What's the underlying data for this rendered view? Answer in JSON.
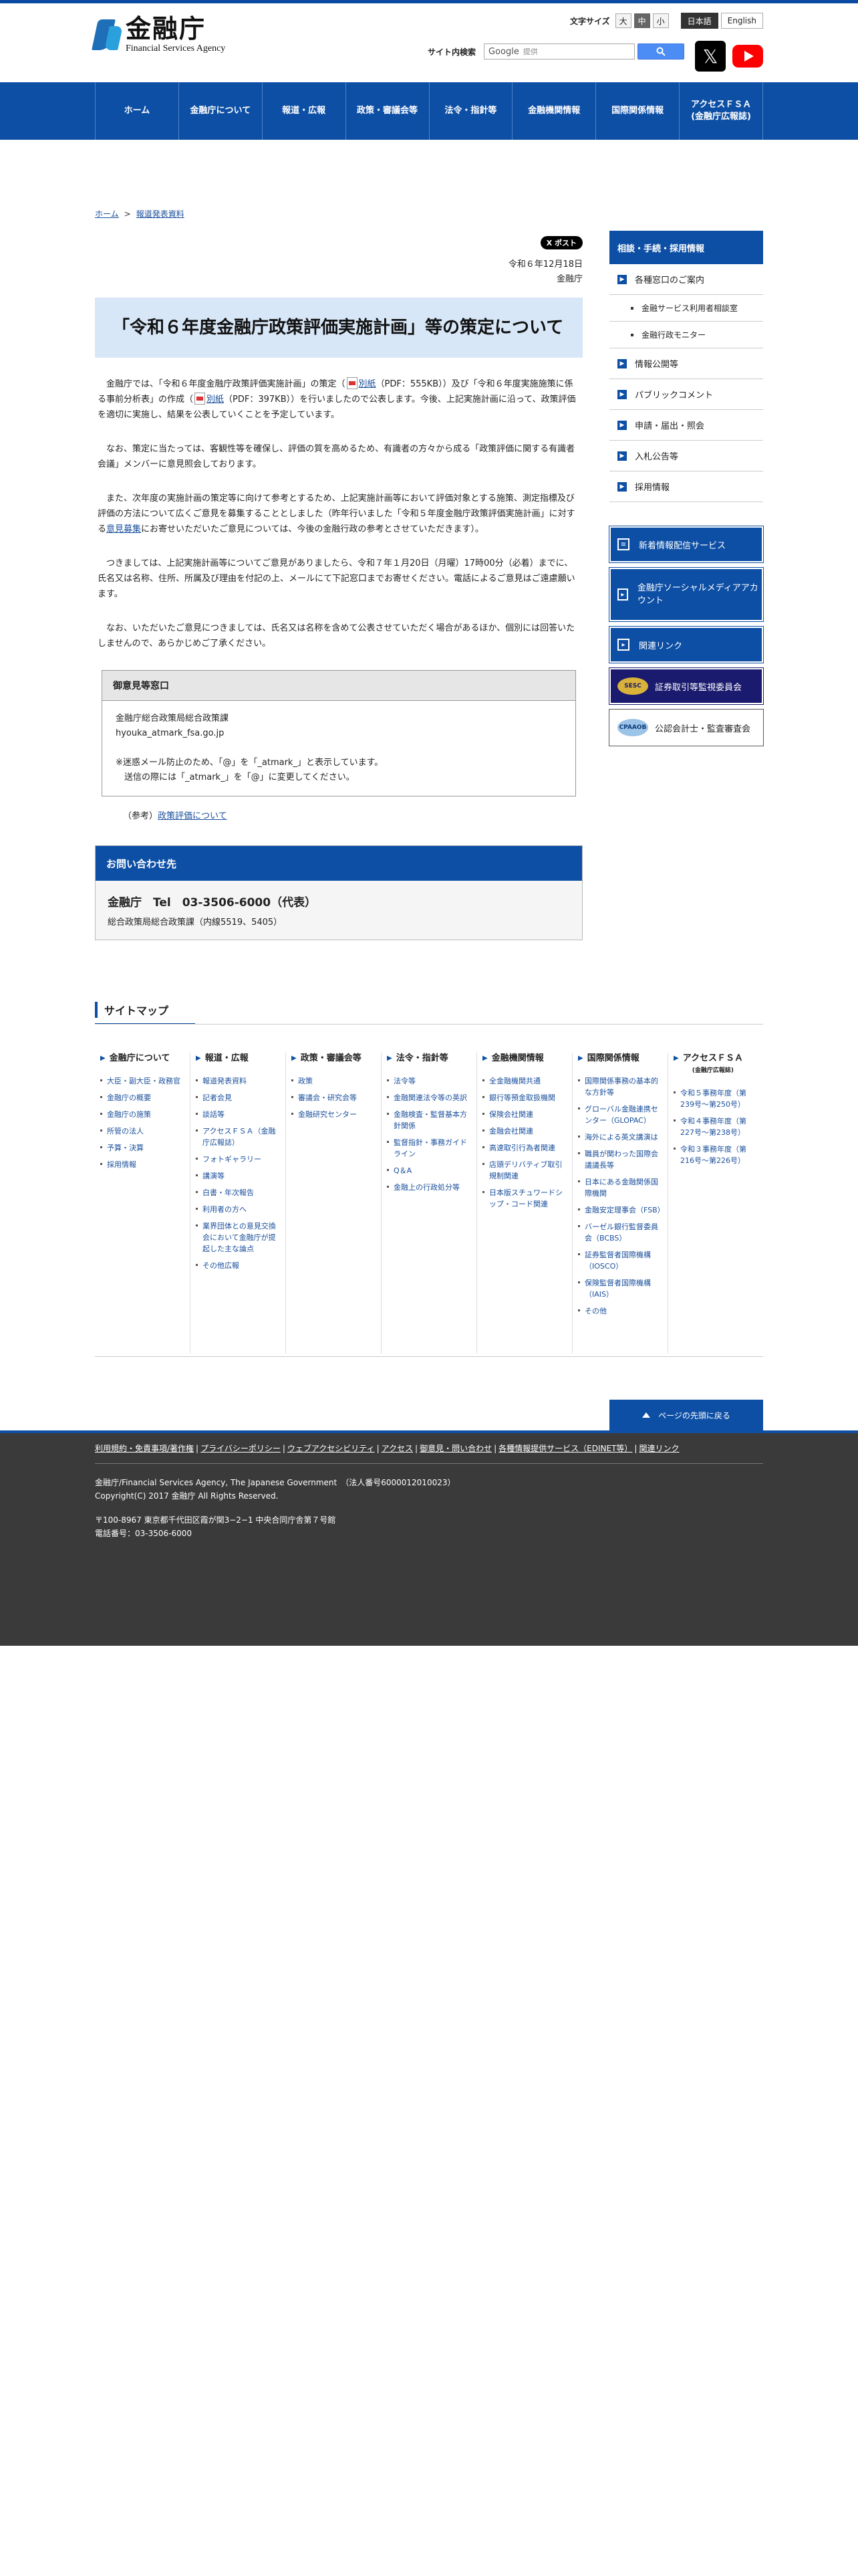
{
  "header": {
    "logo_jp": "金融庁",
    "logo_en": "Financial Services Agency",
    "font_size_label": "文字サイズ",
    "font_sizes": [
      "大",
      "中",
      "小"
    ],
    "langs": [
      "日本語",
      "English"
    ],
    "search_label": "サイト内検索",
    "search_brand": "Google",
    "search_placeholder": "提供"
  },
  "gnav": [
    "ホーム",
    "金融庁について",
    "報道・広報",
    "政策・審議会等",
    "法令・指針等",
    "金融機関情報",
    "国際関係情報",
    "アクセスＦＳＡ\n(金融庁広報誌)"
  ],
  "breadcrumb": {
    "home": "ホーム",
    "sep": ">",
    "current": "報道発表資料"
  },
  "main": {
    "tweet": "X ポスト",
    "date": "令和６年12月18日",
    "org": "金融庁",
    "title": "「令和６年度金融庁政策評価実施計画」等の策定について",
    "p1_a": "金融庁では、「令和６年度金融庁政策評価実施計画」の策定（",
    "p1_link1": "別紙",
    "p1_b": "（PDF：555KB））及び「令和６年度実施施策に係る事前分析表」の作成（",
    "p1_link2": "別紙",
    "p1_c": "（PDF：397KB））を行いましたので公表します。今後、上記実施計画に沿って、政策評価を適切に実施し、結果を公表していくことを予定しています。",
    "p2": "なお、策定に当たっては、客観性等を確保し、評価の質を高めるため、有識者の方々から成る「政策評価に関する有識者会議」メンバーに意見照会しております。",
    "p3_a": "また、次年度の実施計画の策定等に向けて参考とするため、上記実施計画等において評価対象とする施策、測定指標及び評価の方法について広くご意見を募集することとしました（昨年行いました「令和５年度金融庁政策評価実施計画」に対する",
    "p3_link": "意見募集",
    "p3_b": "にお寄せいただいたご意見については、今後の金融行政の参考とさせていただきます）。",
    "p4": "つきましては、上記実施計画等についてご意見がありましたら、令和７年１月20日（月曜）17時00分（必着）までに、氏名又は名称、住所、所属及び理由を付記の上、メールにて下記窓口までお寄せください。電話によるご意見はご遠慮願います。",
    "p5": "なお、いただいたご意見につきましては、氏名又は名称を含めて公表させていただく場合があるほか、個別には回答いたしませんので、あらかじめご了承ください。",
    "box_head": "御意見等窓口",
    "box_l1": "金融庁総合政策局総合政策課",
    "box_l2": "hyouka_atmark_fsa.go.jp",
    "box_l3": "※迷惑メール防止のため、「@」を「_atmark_」と表示しています。",
    "box_l4": "送信の際には「_atmark_」を「@」に変更してください。",
    "ref_prefix": "（参考）",
    "ref_link": "政策評価について",
    "inq_head": "お問い合わせ先",
    "inq_tel": "金融庁　Tel　03-3506-6000（代表）",
    "inq_dept": "総合政策局総合政策課（内線5519、5405）"
  },
  "side": {
    "head": "相談・手続・採用情報",
    "items": [
      {
        "label": "各種窓口のご案内",
        "level": 1
      },
      {
        "label": "金融サービス利用者相談室",
        "level": 2
      },
      {
        "label": "金融行政モニター",
        "level": 2
      },
      {
        "label": "情報公開等",
        "level": 1
      },
      {
        "label": "パブリックコメント",
        "level": 1
      },
      {
        "label": "申請・届出・照会",
        "level": 1
      },
      {
        "label": "入札公告等",
        "level": 1
      },
      {
        "label": "採用情報",
        "level": 1
      }
    ],
    "banner_news": "新着情報配信サービス",
    "banner_social": "金融庁ソーシャルメディアアカウント",
    "banner_links": "関連リンク",
    "banner_sesc": "証券取引等監視委員会",
    "banner_sesc_logo": "SESC",
    "banner_cpaaob": "公認会計士・監査審査会",
    "banner_cpaaob_logo": "CPAAOB"
  },
  "sitemap": {
    "title": "サイトマップ",
    "cols": [
      {
        "head": "金融庁について",
        "items": [
          "大臣・副大臣・政務官",
          "金融庁の概要",
          "金融庁の施策",
          "所管の法人",
          "予算・決算",
          "採用情報"
        ]
      },
      {
        "head": "報道・広報",
        "items": [
          "報道発表資料",
          "記者会見",
          "談話等",
          "アクセスＦＳＡ（金融庁広報誌）",
          "フォトギャラリー",
          "講演等",
          "白書・年次報告",
          "利用者の方へ",
          "業界団体との意見交換会において金融庁が提起した主な論点",
          "その他広報"
        ]
      },
      {
        "head": "政策・審議会等",
        "items": [
          "政策",
          "審議会・研究会等",
          "金融研究センター"
        ]
      },
      {
        "head": "法令・指針等",
        "items": [
          "法令等",
          "金融関連法令等の英訳",
          "金融検査・監督基本方針関係",
          "監督指針・事務ガイドライン",
          "Q＆A",
          "金融上の行政処分等"
        ]
      },
      {
        "head": "金融機関情報",
        "items": [
          "全金融機関共通",
          "銀行等預金取扱機関",
          "保険会社関連",
          "金融会社関連",
          "高速取引行為者関連",
          "店頭デリバティブ取引規制関連",
          "日本版スチュワードシップ・コード関連"
        ]
      },
      {
        "head": "国際関係情報",
        "items": [
          "国際関係事務の基本的な方針等",
          "グローバル金融連携センター（GLOPAC）",
          "海外による英文講演は",
          "職員が関わった国際会議議長等",
          "日本にある金融関係国際機関",
          "金融安定理事会（FSB）",
          "バーゼル銀行監督委員会（BCBS）",
          "証券監督者国際機構（IOSCO）",
          "保険監督者国際機構（IAIS）",
          "その他"
        ]
      },
      {
        "head": "アクセスＦＳＡ",
        "sub": "(金融庁広報誌)",
        "items": [
          "令和５事務年度（第239号〜第250号）",
          "令和４事務年度（第227号〜第238号）",
          "令和３事務年度（第216号〜第226号）"
        ]
      }
    ]
  },
  "totop": "ページの先頭に戻る",
  "footer": {
    "links": [
      "利用規約・免責事項/著作権",
      "プライバシーポリシー",
      "ウェブアクセシビリティ",
      "アクセス",
      "御意見・問い合わせ",
      "各種情報提供サービス（EDINET等）",
      "関連リンク"
    ],
    "line1": "金融庁/Financial Services Agency, The Japanese Government　（法人番号6000012010023）",
    "line2": "Copyright(C) 2017 金融庁 All Rights Reserved.",
    "line3": "〒100-8967 東京都千代田区霞が関3−2−1 中央合同庁舎第７号館",
    "line4": "電話番号：03-3506-6000"
  }
}
